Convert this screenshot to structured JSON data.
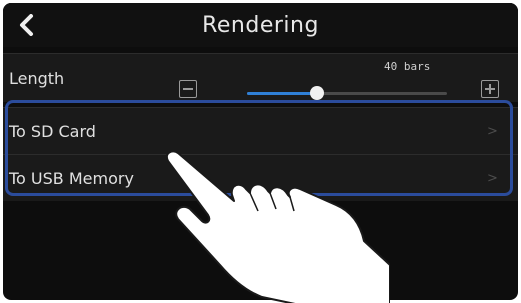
{
  "header": {
    "title": "Rendering",
    "back_icon": "chevron-left-icon"
  },
  "length": {
    "label": "Length",
    "value_label": "40 bars",
    "value_fraction": 0.35,
    "decrease_icon": "minus-box-icon",
    "increase_icon": "plus-box-icon"
  },
  "options": [
    {
      "label": "To SD Card",
      "chevron": ">"
    },
    {
      "label": "To USB Memory",
      "chevron": ">"
    }
  ],
  "colors": {
    "background": "#0d0d0d",
    "accent": "#2f7fd6",
    "highlight": "#2b4c9c"
  }
}
